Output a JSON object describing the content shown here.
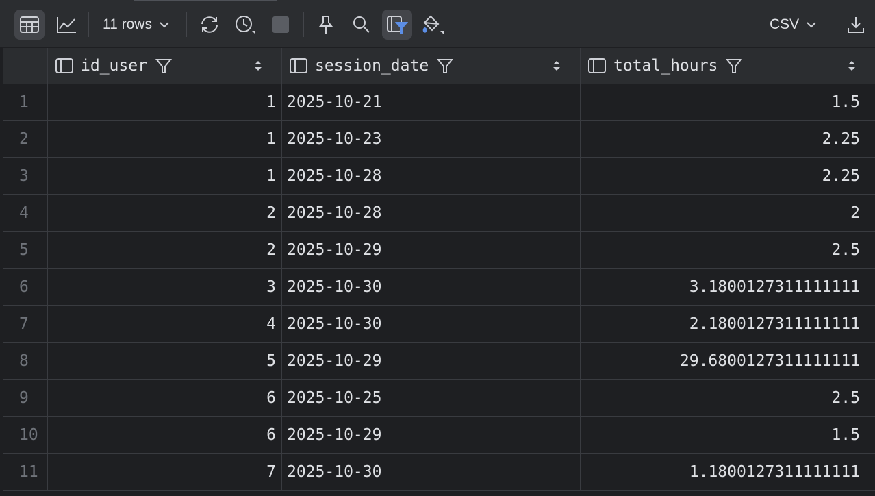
{
  "toolbar": {
    "rows_label": "11 rows",
    "export_format": "CSV"
  },
  "columns": [
    {
      "name": "id_user"
    },
    {
      "name": "session_date"
    },
    {
      "name": "total_hours"
    }
  ],
  "rows": [
    {
      "n": "1",
      "id_user": "1",
      "session_date": "2025-10-21",
      "total_hours": "1.5"
    },
    {
      "n": "2",
      "id_user": "1",
      "session_date": "2025-10-23",
      "total_hours": "2.25"
    },
    {
      "n": "3",
      "id_user": "1",
      "session_date": "2025-10-28",
      "total_hours": "2.25"
    },
    {
      "n": "4",
      "id_user": "2",
      "session_date": "2025-10-28",
      "total_hours": "2"
    },
    {
      "n": "5",
      "id_user": "2",
      "session_date": "2025-10-29",
      "total_hours": "2.5"
    },
    {
      "n": "6",
      "id_user": "3",
      "session_date": "2025-10-30",
      "total_hours": "3.1800127311111111"
    },
    {
      "n": "7",
      "id_user": "4",
      "session_date": "2025-10-30",
      "total_hours": "2.1800127311111111"
    },
    {
      "n": "8",
      "id_user": "5",
      "session_date": "2025-10-29",
      "total_hours": "29.6800127311111111"
    },
    {
      "n": "9",
      "id_user": "6",
      "session_date": "2025-10-25",
      "total_hours": "2.5"
    },
    {
      "n": "10",
      "id_user": "6",
      "session_date": "2025-10-29",
      "total_hours": "1.5"
    },
    {
      "n": "11",
      "id_user": "7",
      "session_date": "2025-10-30",
      "total_hours": "1.1800127311111111"
    }
  ]
}
